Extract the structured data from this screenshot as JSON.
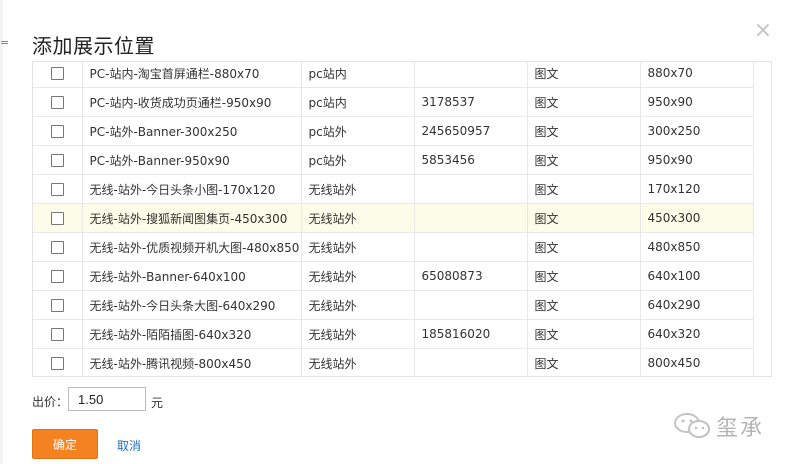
{
  "dialog": {
    "title": "添加展示位置",
    "close_glyph": "×",
    "left_edge_mark": "="
  },
  "placements": {
    "rows": [
      {
        "name": "PC-站内-淘宝首屏通栏-880x70",
        "scope": "pc站内",
        "id": "",
        "type": "图文",
        "size": "880x70",
        "highlight": false
      },
      {
        "name": "PC-站内-收货成功页通栏-950x90",
        "scope": "pc站内",
        "id": "3178537",
        "type": "图文",
        "size": "950x90",
        "highlight": false
      },
      {
        "name": "PC-站外-Banner-300x250",
        "scope": "pc站外",
        "id": "245650957",
        "type": "图文",
        "size": "300x250",
        "highlight": false
      },
      {
        "name": "PC-站外-Banner-950x90",
        "scope": "pc站外",
        "id": "5853456",
        "type": "图文",
        "size": "950x90",
        "highlight": false
      },
      {
        "name": "无线-站外-今日头条小图-170x120",
        "scope": "无线站外",
        "id": "",
        "type": "图文",
        "size": "170x120",
        "highlight": false
      },
      {
        "name": "无线-站外-搜狐新闻图集页-450x300",
        "scope": "无线站外",
        "id": "",
        "type": "图文",
        "size": "450x300",
        "highlight": true
      },
      {
        "name": "无线-站外-优质视频开机大图-480x850",
        "scope": "无线站外",
        "id": "",
        "type": "图文",
        "size": "480x850",
        "highlight": false
      },
      {
        "name": "无线-站外-Banner-640x100",
        "scope": "无线站外",
        "id": "65080873",
        "type": "图文",
        "size": "640x100",
        "highlight": false
      },
      {
        "name": "无线-站外-今日头条大图-640x290",
        "scope": "无线站外",
        "id": "",
        "type": "图文",
        "size": "640x290",
        "highlight": false
      },
      {
        "name": "无线-站外-陌陌插图-640x320",
        "scope": "无线站外",
        "id": "185816020",
        "type": "图文",
        "size": "640x320",
        "highlight": false
      },
      {
        "name": "无线-站外-腾讯视频-800x450",
        "scope": "无线站外",
        "id": "",
        "type": "图文",
        "size": "800x450",
        "highlight": false
      }
    ],
    "scroll_up_glyph": "⌃",
    "scroll_down_glyph": "⌄"
  },
  "bid": {
    "label": "出价：",
    "value": "1.50",
    "unit": "元"
  },
  "actions": {
    "confirm_label": "确定",
    "cancel_label": "取消"
  },
  "watermark": {
    "text": "玺承",
    "icon": "wechat-icon"
  },
  "colors": {
    "accent": "#f58220",
    "link": "#1f6fc4",
    "row_highlight": "#fdfce8"
  }
}
